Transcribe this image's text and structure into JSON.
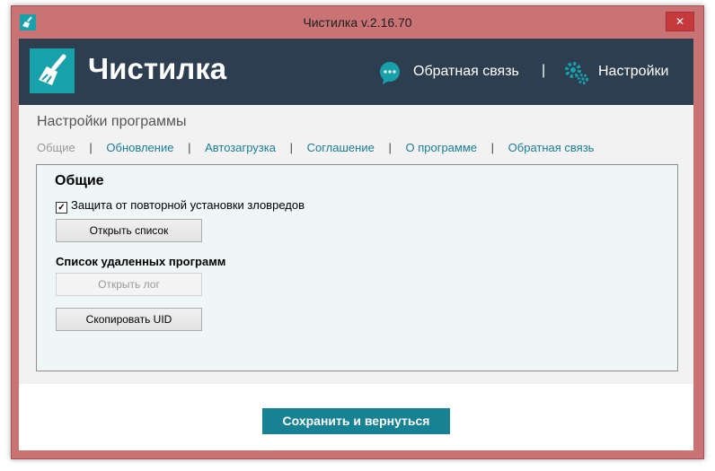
{
  "window": {
    "title": "Чистилка v.2.16.70",
    "close_glyph": "✕"
  },
  "header": {
    "app_name": "Чистилка",
    "feedback_label": "Обратная связь",
    "separator": "|",
    "settings_label": "Настройки"
  },
  "main": {
    "page_title": "Настройки программы",
    "tabs": [
      {
        "label": "Общие",
        "active": true
      },
      {
        "label": "Обновление"
      },
      {
        "label": "Автозагрузка"
      },
      {
        "label": "Соглашение"
      },
      {
        "label": "О программе"
      },
      {
        "label": "Обратная связь"
      }
    ],
    "tab_separator": "|",
    "panel": {
      "title": "Общие",
      "checkbox_label": "Защита от повторной установки зловредов",
      "checkbox_checked": true,
      "checkbox_mark": "✓",
      "open_list_button": "Открыть список",
      "removed_programs_heading": "Список удаленных программ",
      "open_log_button": "Открыть лог",
      "copy_uid_button": "Скопировать UID"
    }
  },
  "footer": {
    "save_button": "Сохранить и вернуться"
  },
  "icons": {
    "app": "broom-icon",
    "logo": "broom-icon",
    "feedback": "chat-bubble-icon",
    "settings": "gears-icon",
    "close": "close-icon"
  },
  "colors": {
    "window_frame": "#c97374",
    "header_bg": "#2c3e50",
    "logo_bg": "#17a2ab",
    "accent": "#168293",
    "link": "#1a7d98",
    "panel_bg": "#eef6f6"
  }
}
